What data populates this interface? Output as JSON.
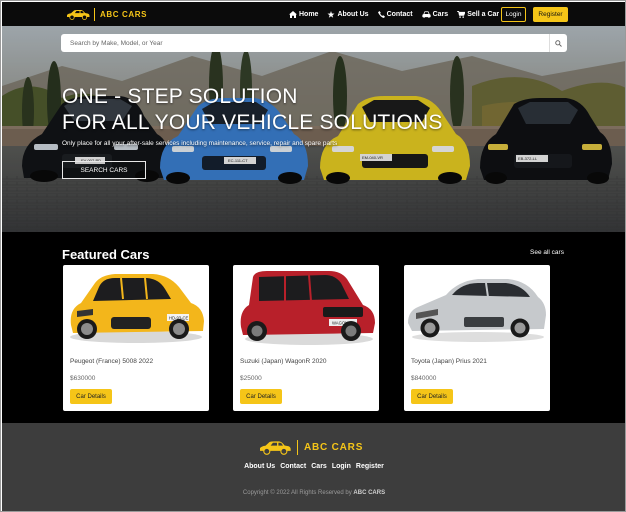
{
  "brand": {
    "name": "ABC CARS",
    "logo_icon": "yellow-car-logo",
    "accent_color": "#f5c518"
  },
  "nav": {
    "links": [
      {
        "label": "Home",
        "icon": "home-icon"
      },
      {
        "label": "About Us",
        "icon": "star-icon"
      },
      {
        "label": "Contact",
        "icon": "phone-icon"
      },
      {
        "label": "Cars",
        "icon": "car-icon"
      },
      {
        "label": "Sell a Car",
        "icon": "cart-icon"
      }
    ],
    "login_label": "Login",
    "register_label": "Register"
  },
  "hero": {
    "search_placeholder": "Search by Make, Model, or Year",
    "title_line1": "ONE - STEP SOLUTION",
    "title_line2": "FOR ALL YOUR VEHICLE SOLUTIONS",
    "subtitle": "Only place for all your after-sale services including maintenance, service, repair and spare parts",
    "cta_label": "SEARCH CARS",
    "plates": [
      "EV-007-PD",
      "EC-111-CT",
      "EM-040-VR",
      "EB-372-LL"
    ]
  },
  "featured": {
    "title": "Featured Cars",
    "see_all_label": "See all cars",
    "cars": [
      {
        "name": "Peugeot (France) 5008 2022",
        "price": "$630000",
        "button": "Car Details",
        "plate": "HD-93-CE"
      },
      {
        "name": "Suzuki (Japan) WagonR 2020",
        "price": "$25000",
        "button": "Car Details",
        "plate": "WAGON R"
      },
      {
        "name": "Toyota (Japan) Prius 2021",
        "price": "$840000",
        "button": "Car Details",
        "plate": ""
      }
    ]
  },
  "footer": {
    "brand": "ABC CARS",
    "links": [
      "About Us",
      "Contact",
      "Cars",
      "Login",
      "Register"
    ],
    "copyright_prefix": "Copyright © 2022 All Rights Reserved by",
    "copyright_brand": "ABC CARS"
  }
}
